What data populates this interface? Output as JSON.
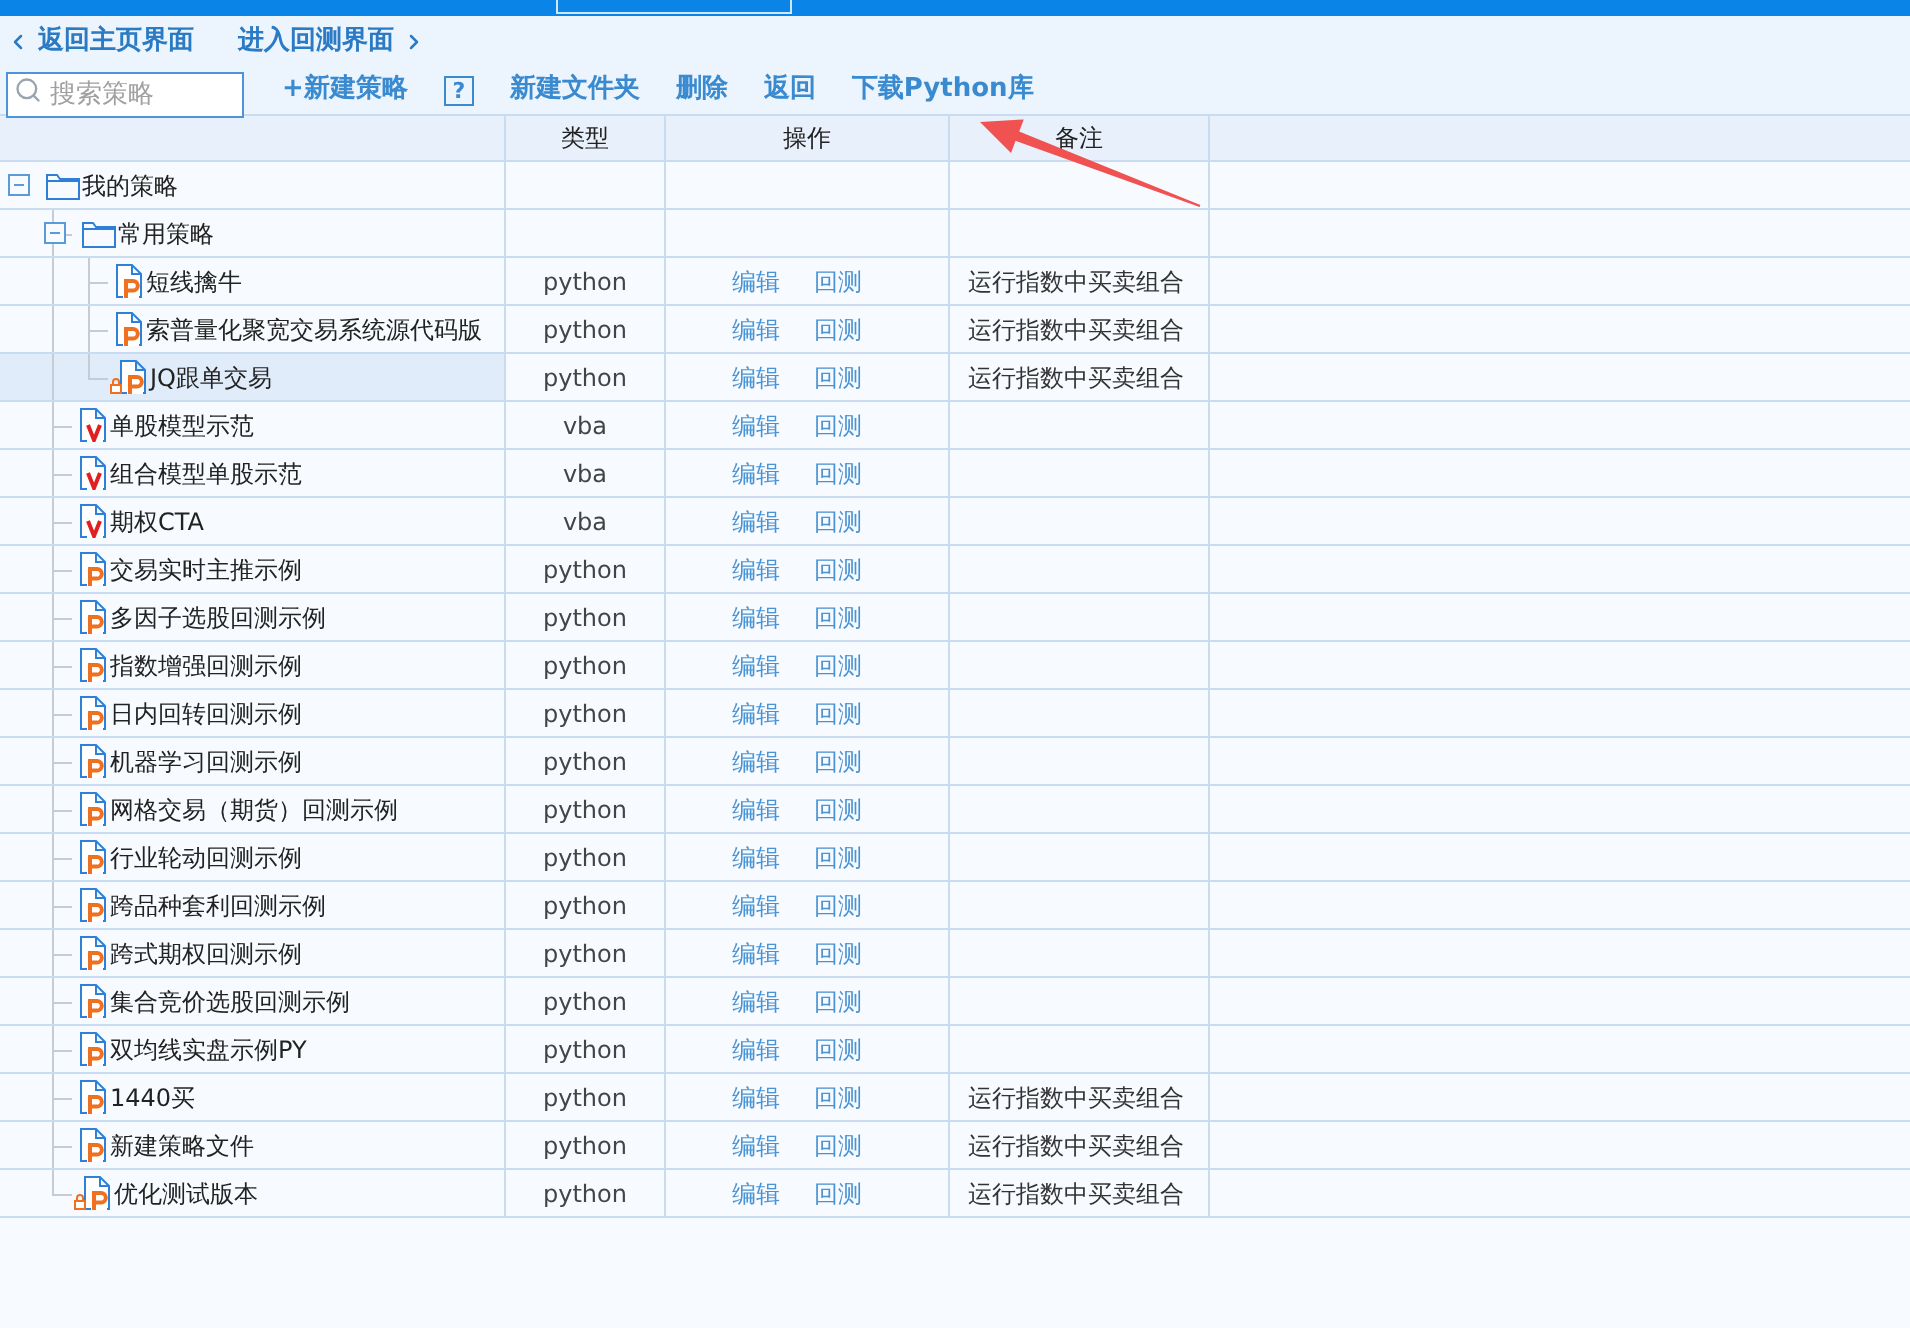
{
  "nav": {
    "links": [
      {
        "kind": "back",
        "label": "返回主页界面"
      },
      {
        "kind": "forward",
        "label": "进入回测界面"
      }
    ]
  },
  "toolbar": {
    "search": {
      "placeholder": "搜索策略"
    },
    "items": [
      {
        "kind": "link",
        "label": "+新建策略"
      },
      {
        "kind": "help",
        "label": "?"
      },
      {
        "kind": "link",
        "label": "新建文件夹"
      },
      {
        "kind": "link",
        "label": "删除"
      },
      {
        "kind": "link",
        "label": "返回"
      },
      {
        "kind": "link",
        "label": "下载Python库"
      }
    ]
  },
  "table": {
    "columns": [
      "类型",
      "操作",
      "备注"
    ],
    "tree": [
      {
        "name": "我的策略",
        "kind": "folder",
        "expanded": true,
        "selected": false,
        "children": [
          {
            "name": "常用策略",
            "kind": "folder",
            "expanded": true,
            "selected": false,
            "children": [
              {
                "name": "短线擒牛",
                "kind": "python",
                "locked": false,
                "selected": false,
                "type": "python",
                "actions": [
                  "编辑",
                  "回测"
                ],
                "note": "运行指数中买卖组合"
              },
              {
                "name": "索普量化聚宽交易系统源代码版",
                "kind": "python",
                "locked": false,
                "selected": false,
                "type": "python",
                "actions": [
                  "编辑",
                  "回测"
                ],
                "note": "运行指数中买卖组合"
              },
              {
                "name": "JQ跟单交易",
                "kind": "python",
                "locked": true,
                "selected": true,
                "type": "python",
                "actions": [
                  "编辑",
                  "回测"
                ],
                "note": "运行指数中买卖组合"
              }
            ]
          },
          {
            "name": "单股模型示范",
            "kind": "vba",
            "locked": false,
            "selected": false,
            "type": "vba",
            "actions": [
              "编辑",
              "回测"
            ]
          },
          {
            "name": "组合模型单股示范",
            "kind": "vba",
            "locked": false,
            "selected": false,
            "type": "vba",
            "actions": [
              "编辑",
              "回测"
            ]
          },
          {
            "name": "期权CTA",
            "kind": "vba",
            "locked": false,
            "selected": false,
            "type": "vba",
            "actions": [
              "编辑",
              "回测"
            ]
          },
          {
            "name": "交易实时主推示例",
            "kind": "python",
            "locked": false,
            "selected": false,
            "type": "python",
            "actions": [
              "编辑",
              "回测"
            ]
          },
          {
            "name": "多因子选股回测示例",
            "kind": "python",
            "locked": false,
            "selected": false,
            "type": "python",
            "actions": [
              "编辑",
              "回测"
            ]
          },
          {
            "name": "指数增强回测示例",
            "kind": "python",
            "locked": false,
            "selected": false,
            "type": "python",
            "actions": [
              "编辑",
              "回测"
            ]
          },
          {
            "name": "日内回转回测示例",
            "kind": "python",
            "locked": false,
            "selected": false,
            "type": "python",
            "actions": [
              "编辑",
              "回测"
            ]
          },
          {
            "name": "机器学习回测示例",
            "kind": "python",
            "locked": false,
            "selected": false,
            "type": "python",
            "actions": [
              "编辑",
              "回测"
            ]
          },
          {
            "name": "网格交易（期货）回测示例",
            "kind": "python",
            "locked": false,
            "selected": false,
            "type": "python",
            "actions": [
              "编辑",
              "回测"
            ]
          },
          {
            "name": "行业轮动回测示例",
            "kind": "python",
            "locked": false,
            "selected": false,
            "type": "python",
            "actions": [
              "编辑",
              "回测"
            ]
          },
          {
            "name": "跨品种套利回测示例",
            "kind": "python",
            "locked": false,
            "selected": false,
            "type": "python",
            "actions": [
              "编辑",
              "回测"
            ]
          },
          {
            "name": "跨式期权回测示例",
            "kind": "python",
            "locked": false,
            "selected": false,
            "type": "python",
            "actions": [
              "编辑",
              "回测"
            ]
          },
          {
            "name": "集合竞价选股回测示例",
            "kind": "python",
            "locked": false,
            "selected": false,
            "type": "python",
            "actions": [
              "编辑",
              "回测"
            ]
          },
          {
            "name": "双均线实盘示例PY",
            "kind": "python",
            "locked": false,
            "selected": false,
            "type": "python",
            "actions": [
              "编辑",
              "回测"
            ]
          },
          {
            "name": "1440买",
            "kind": "python",
            "locked": false,
            "selected": false,
            "type": "python",
            "actions": [
              "编辑",
              "回测"
            ],
            "note": "运行指数中买卖组合"
          },
          {
            "name": "新建策略文件",
            "kind": "python",
            "locked": false,
            "selected": false,
            "type": "python",
            "actions": [
              "编辑",
              "回测"
            ],
            "note": "运行指数中买卖组合"
          },
          {
            "name": "优化测试版本",
            "kind": "python",
            "locked": true,
            "selected": false,
            "type": "python",
            "actions": [
              "编辑",
              "回测"
            ],
            "note": "运行指数中买卖组合"
          }
        ]
      }
    ]
  }
}
